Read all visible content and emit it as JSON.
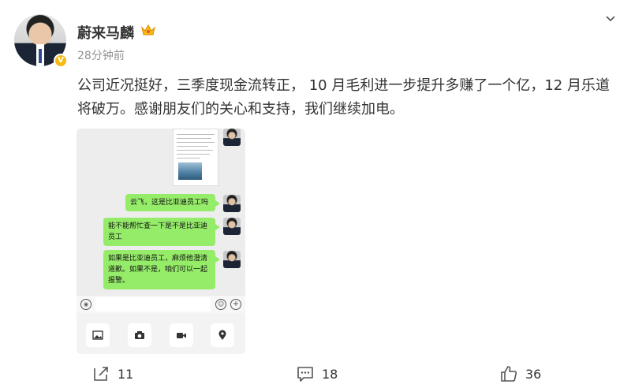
{
  "post": {
    "author": "蔚来马麟",
    "timestamp": "28分钟前",
    "text": "公司近况挺好，三季度现金流转正， 10 月毛利进一步提升多赚了一个亿，12 月乐道将破万。感谢朋友们的关心和支持，我们继续加电。"
  },
  "chat_screenshot": {
    "messages": [
      "云飞，这是比亚迪员工吗",
      "能不能帮忙查一下是不是比亚迪员工",
      "如果是比亚迪员工，麻烦他澄清道歉。如果不是，咱们可以一起报警。"
    ]
  },
  "actions": {
    "repost_count": "11",
    "comment_count": "18",
    "like_count": "36"
  },
  "colors": {
    "accent": "#f5b914",
    "bubble": "#95ec69",
    "meta": "#939393"
  },
  "icons": [
    "crown-icon",
    "verified-icon",
    "chevron-down-icon",
    "repost-icon",
    "comment-icon",
    "like-icon",
    "voice-icon",
    "emoji-icon",
    "plus-icon",
    "image-icon",
    "camera-icon",
    "video-icon",
    "location-icon"
  ]
}
